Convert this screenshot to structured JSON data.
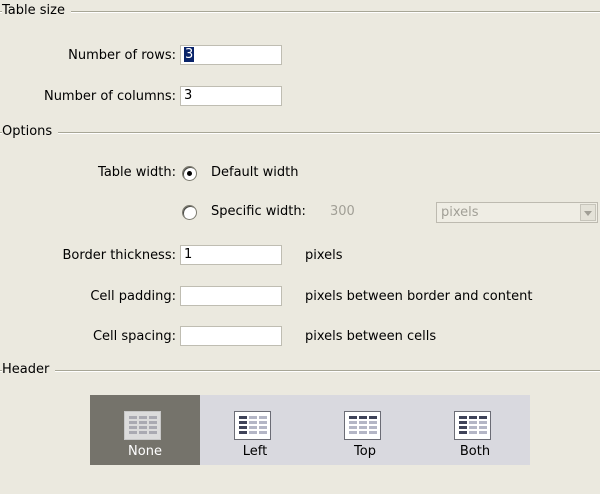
{
  "table_size": {
    "title": "Table size",
    "rows_label": "Number of rows:",
    "rows_value": "3",
    "columns_label": "Number of columns:",
    "columns_value": "3"
  },
  "options": {
    "title": "Options",
    "table_width_label": "Table width:",
    "default_width_label": "Default width",
    "default_width_selected": true,
    "specific_width_label": "Specific width:",
    "specific_width_value": "300",
    "units_value": "pixels",
    "border_label": "Border thickness:",
    "border_value": "1",
    "border_units": "pixels",
    "padding_label": "Cell padding:",
    "padding_value": "",
    "padding_units": "pixels between border and content",
    "spacing_label": "Cell spacing:",
    "spacing_value": "",
    "spacing_units": "pixels between cells"
  },
  "header": {
    "title": "Header",
    "selected": "None",
    "choices": [
      {
        "label": "None"
      },
      {
        "label": "Left"
      },
      {
        "label": "Top"
      },
      {
        "label": "Both"
      }
    ]
  },
  "icons": {
    "radio": "radio-button-icon",
    "table_icon": "table-grid-icon",
    "dropdown": "chevron-down-icon"
  },
  "colors": {
    "background": "#ebe9df",
    "selected_header_bg": "#75736b",
    "header_button_bg": "#d9d9df",
    "text_selection": "#0a246a"
  }
}
